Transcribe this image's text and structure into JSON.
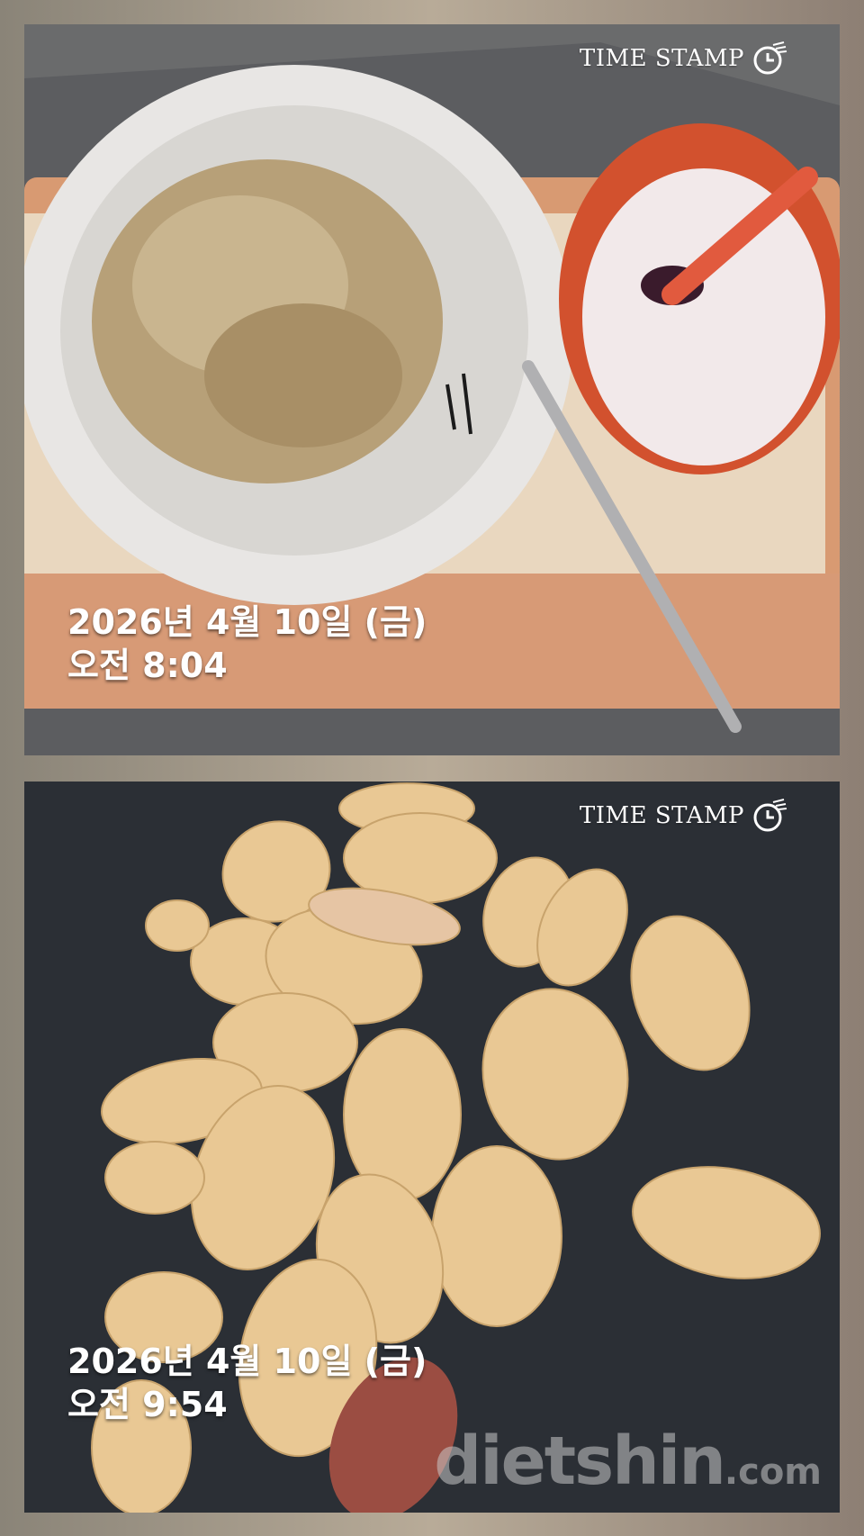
{
  "photos": [
    {
      "stamp_label": "TIME STAMP",
      "date": "2026년 4월 10일 (금)",
      "time": "오전 8:04",
      "stamp_icon": "clock-icon"
    },
    {
      "stamp_label": "TIME STAMP",
      "date": "2026년 4월 10일 (금)",
      "time": "오전 9:54",
      "stamp_icon": "clock-icon"
    }
  ],
  "watermark": {
    "brand": "dietshin",
    "suffix": ".com"
  }
}
